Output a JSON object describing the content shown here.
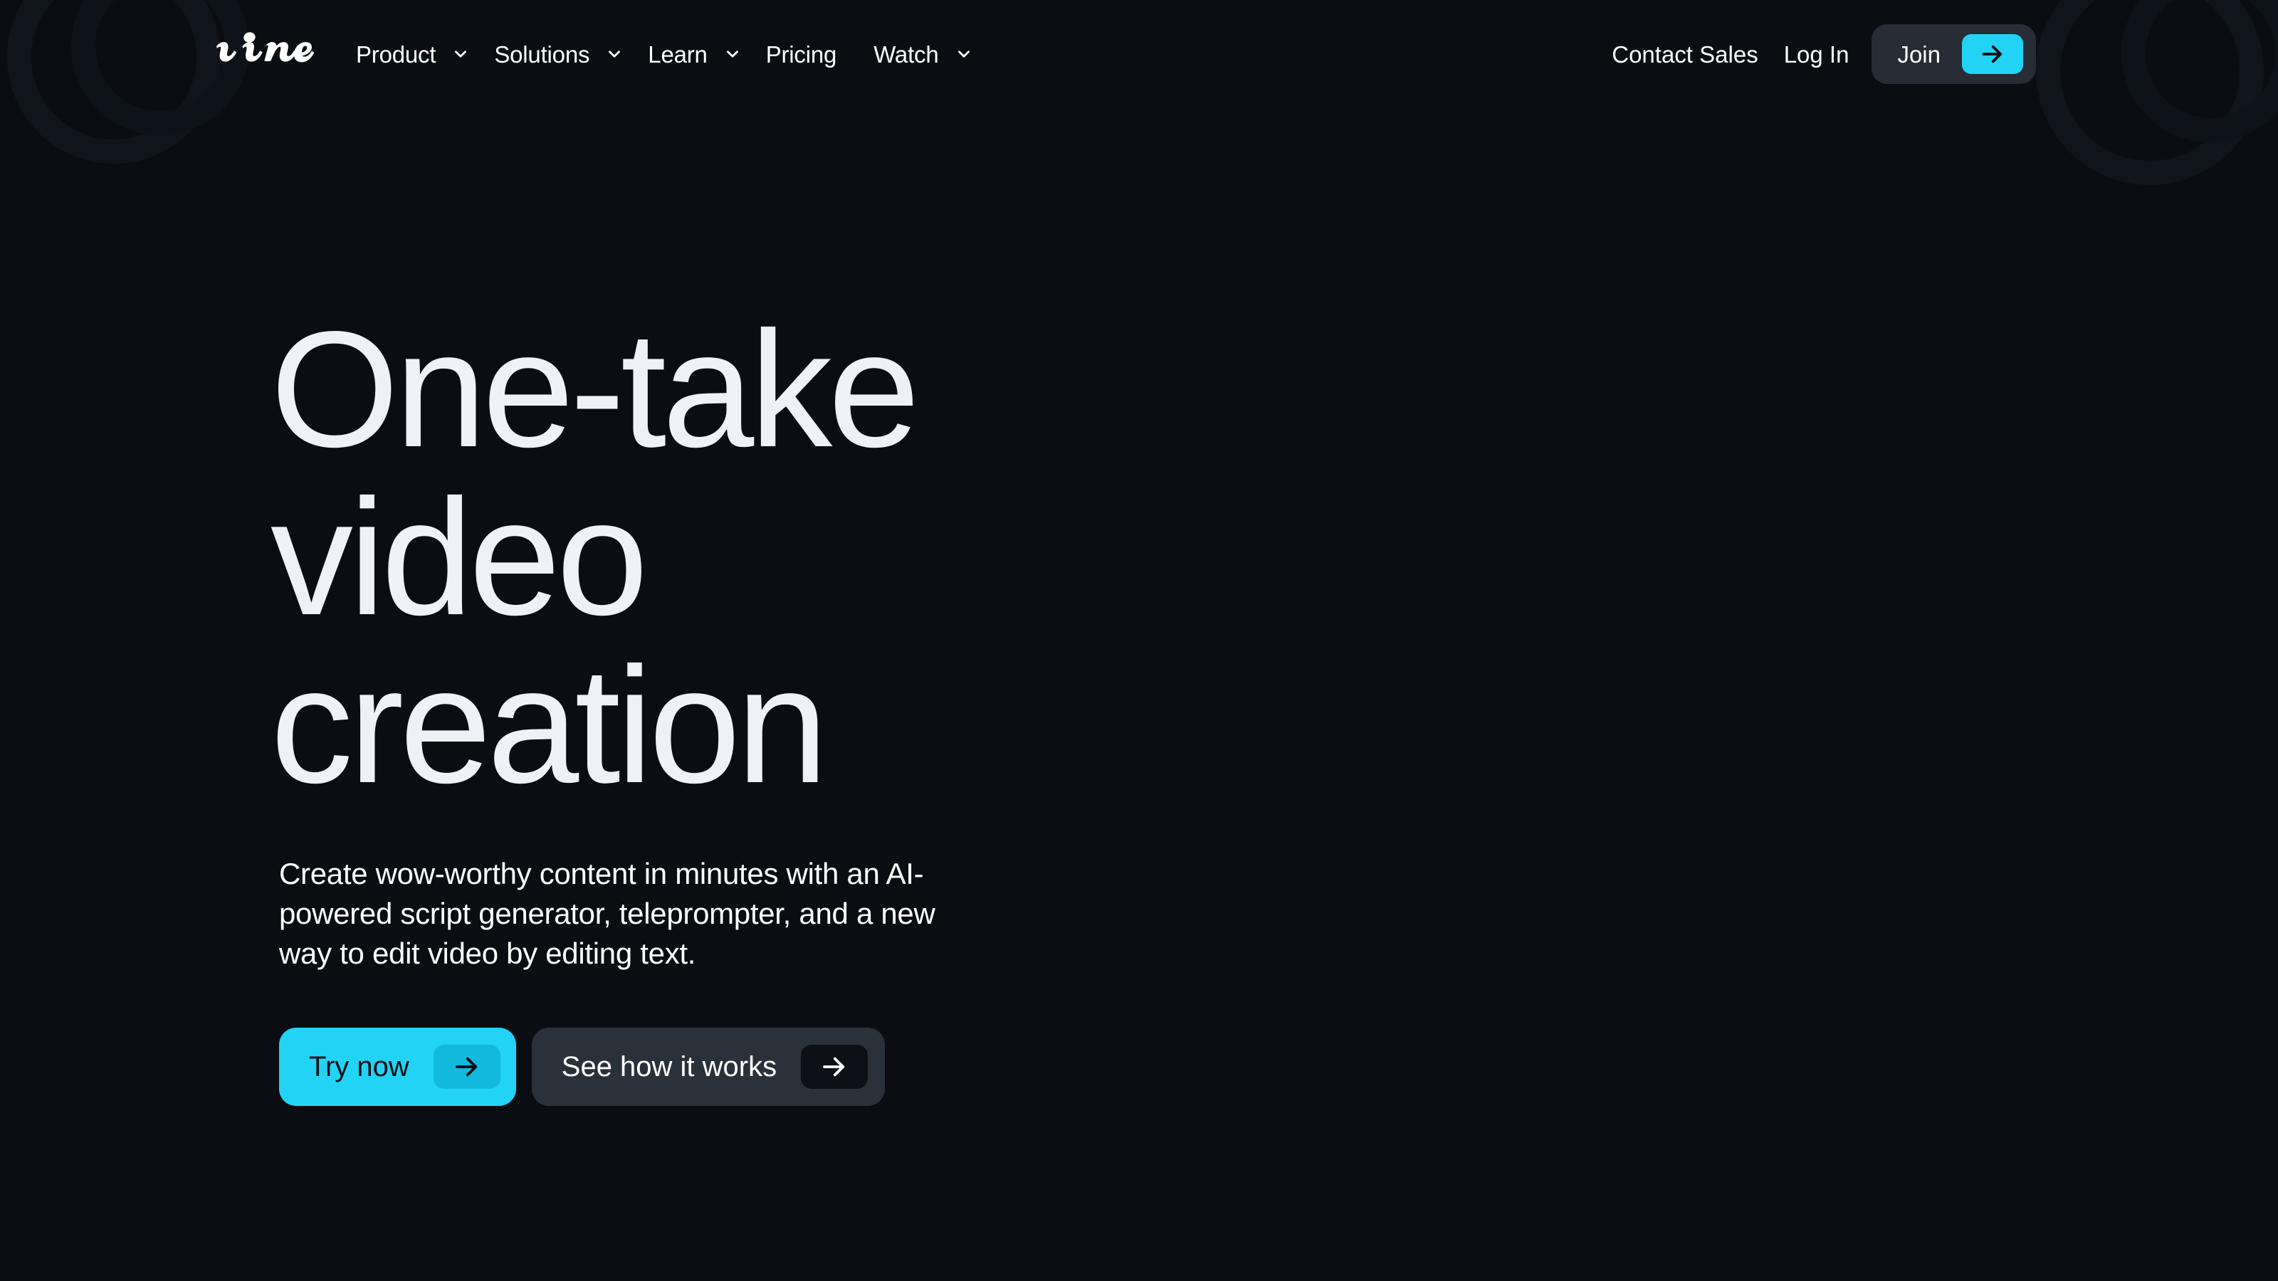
{
  "colors": {
    "background": "#0a0e13",
    "accent_cyan": "#22d3f5",
    "accent_cyan_dark": "#13b9dd",
    "surface_dark": "#2b313a",
    "surface_darker": "#272c35",
    "text_primary": "#ffffff",
    "headline_color": "#eef2f7",
    "arrow_box_dark": "#0d1117"
  },
  "header": {
    "logo_text": "vimeo",
    "logo_icon": "vimeo-wordmark-logo",
    "nav_items": [
      {
        "label": "Product",
        "has_dropdown": true,
        "icon": "chevron-down-icon"
      },
      {
        "label": "Solutions",
        "has_dropdown": true,
        "icon": "chevron-down-icon"
      },
      {
        "label": "Learn",
        "has_dropdown": true,
        "icon": "chevron-down-icon"
      },
      {
        "label": "Pricing",
        "has_dropdown": false,
        "icon": ""
      },
      {
        "label": "Watch",
        "has_dropdown": true,
        "icon": "chevron-down-icon"
      }
    ],
    "contact_sales_label": "Contact Sales",
    "log_in_label": "Log In",
    "join_label": "Join",
    "join_arrow_icon": "arrow-right-icon"
  },
  "hero": {
    "headline_line_1": "One-take",
    "headline_line_2": "video",
    "headline_line_3": "creation",
    "subheading": "Create wow-worthy content in minutes with an AI-powered script generator, teleprompter, and a new way to edit video by editing text.",
    "primary_cta": {
      "label": "Try now",
      "arrow_icon": "arrow-right-icon"
    },
    "secondary_cta": {
      "label": "See how it works",
      "arrow_icon": "arrow-right-icon"
    }
  }
}
